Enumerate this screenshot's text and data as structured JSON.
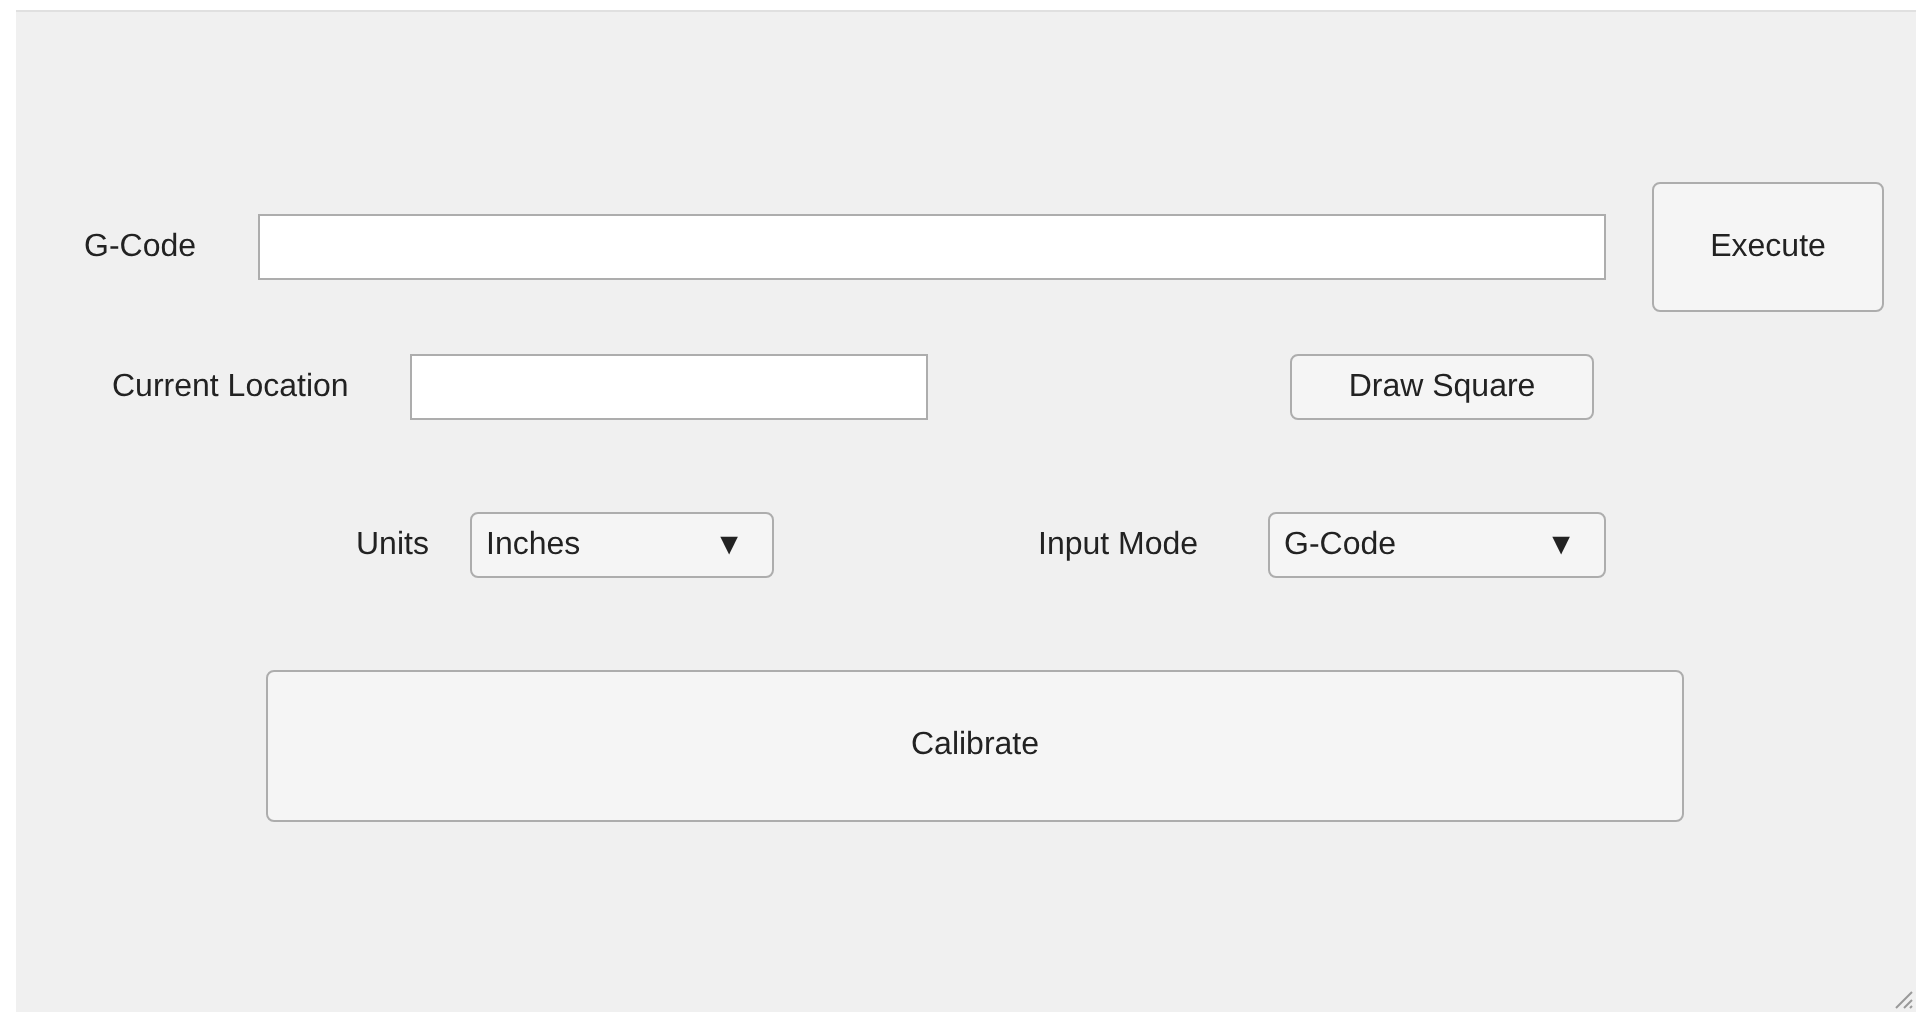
{
  "gcode": {
    "label": "G-Code"
  },
  "execute_button": {
    "label": "Execute"
  },
  "current_location": {
    "label": "Current Location"
  },
  "draw_square_button": {
    "label": "Draw Square"
  },
  "units": {
    "label": "Units",
    "value": "Inches",
    "arrow": "▼"
  },
  "input_mode": {
    "label": "Input Mode",
    "value": "G-Code",
    "arrow": "▼"
  },
  "calibrate_button": {
    "label": "Calibrate"
  }
}
